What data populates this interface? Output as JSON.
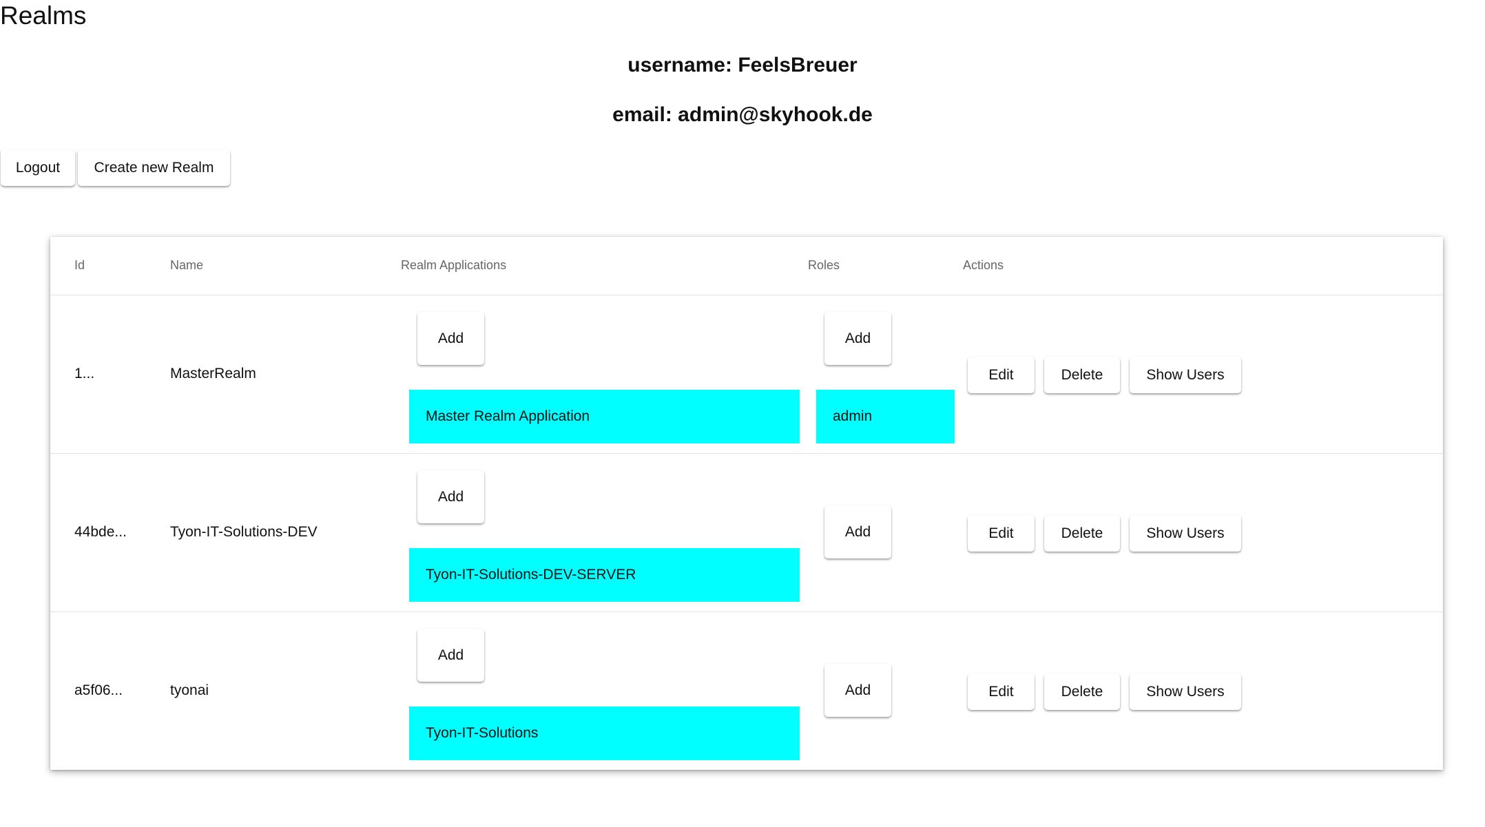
{
  "page_title": "Realms",
  "user": {
    "username_line": "username: FeelsBreuer",
    "email_line": "email: admin@skyhook.de"
  },
  "toolbar": {
    "logout_label": "Logout",
    "create_label": "Create new Realm"
  },
  "table": {
    "columns": [
      "Id",
      "Name",
      "Realm Applications",
      "Roles",
      "Actions"
    ],
    "add_label": "Add",
    "actions": {
      "edit": "Edit",
      "delete": "Delete",
      "show_users": "Show Users"
    },
    "rows": [
      {
        "id": "1...",
        "name": "MasterRealm",
        "applications": [
          "Master Realm Application"
        ],
        "roles": [
          "admin"
        ]
      },
      {
        "id": "44bde...",
        "name": "Tyon-IT-Solutions-DEV",
        "applications": [
          "Tyon-IT-Solutions-DEV-SERVER"
        ],
        "roles": []
      },
      {
        "id": "a5f06...",
        "name": "tyonai",
        "applications": [
          "Tyon-IT-Solutions"
        ],
        "roles": []
      }
    ]
  },
  "colors": {
    "chip": "#00ffff",
    "background": "#ffffff"
  }
}
